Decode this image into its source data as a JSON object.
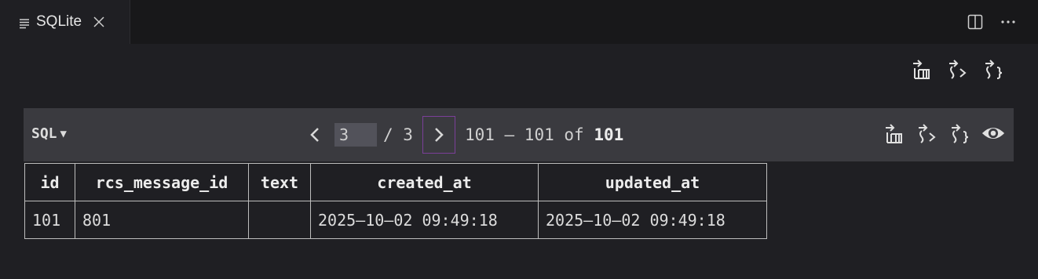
{
  "tab": {
    "title": "SQLite",
    "icon": "document-lines-icon"
  },
  "tab_actions": [
    {
      "name": "split-editor-icon"
    },
    {
      "name": "more-actions-icon",
      "glyph": "···"
    }
  ],
  "export_icons": [
    "export-csv-icon",
    "export-html-icon",
    "export-json-icon"
  ],
  "toolbar": {
    "sql_label": "SQL",
    "sql_caret": "▼",
    "prev_label": "<",
    "next_label": ">",
    "current_page": "3",
    "total_pages": "/ 3",
    "range_label": "101 – 101 of",
    "total_rows": "101",
    "icons": [
      "export-csv-icon",
      "export-html-icon",
      "export-json-icon",
      "eye-icon"
    ]
  },
  "table": {
    "columns": [
      "id",
      "rcs_message_id",
      "text",
      "created_at",
      "updated_at"
    ],
    "rows": [
      [
        "101",
        "801",
        "",
        "2025–10–02 09:49:18",
        "2025–10–02 09:49:18"
      ]
    ]
  },
  "colors": {
    "background": "#1f1f23",
    "toolbar": "#3a3a3f",
    "focus_border": "#7b3f99"
  }
}
